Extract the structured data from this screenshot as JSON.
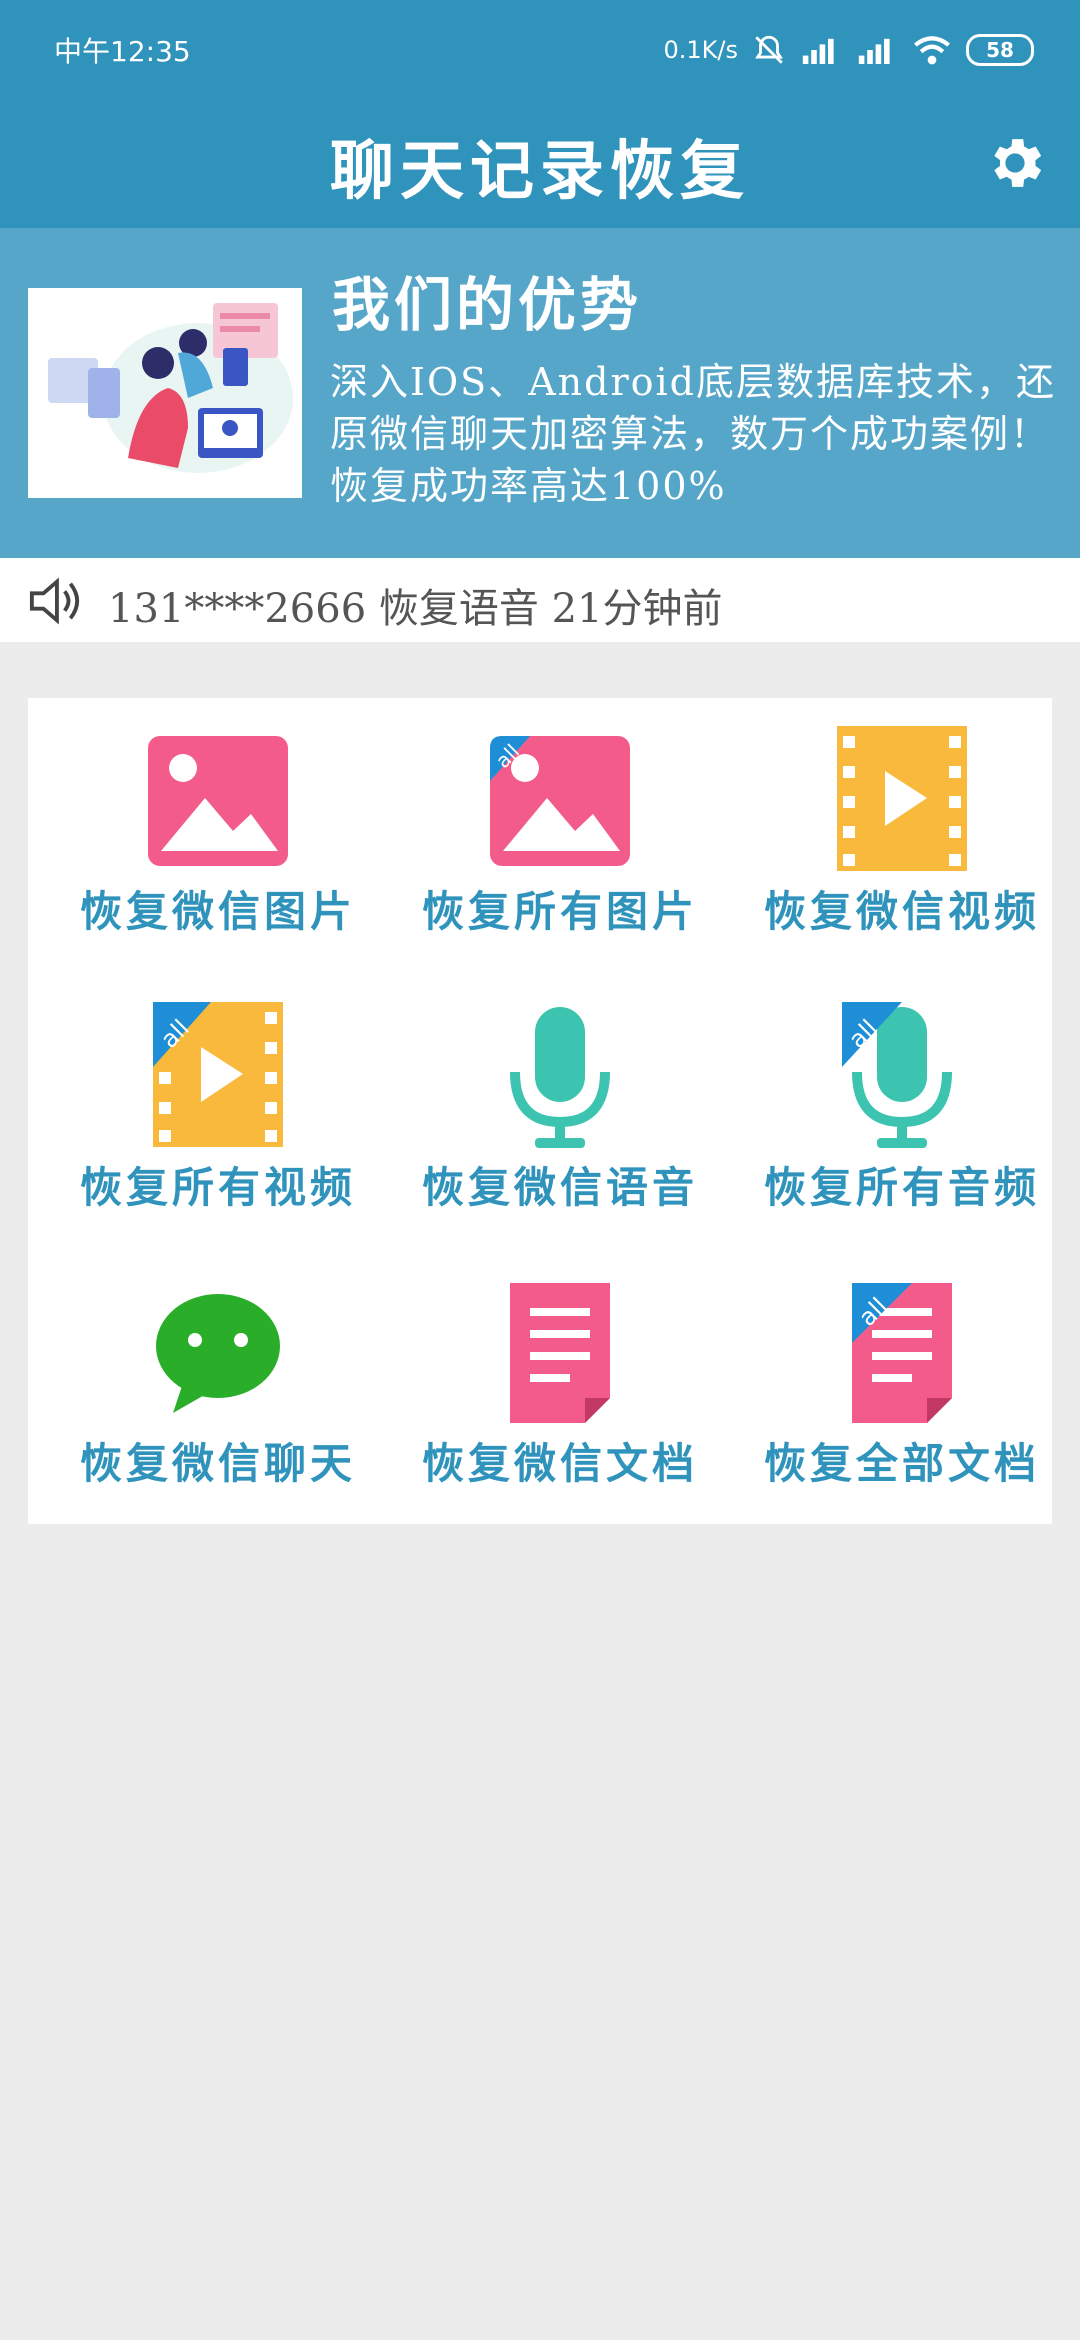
{
  "status_bar": {
    "time": "中午12:35",
    "speed": "0.1K/s",
    "battery": "58",
    "icons": [
      "bell-off-icon",
      "signal-hd-icon",
      "signal-icon",
      "wifi-icon",
      "battery-icon"
    ]
  },
  "app_bar": {
    "title": "聊天记录恢复",
    "settings_icon": "gear-icon"
  },
  "banner": {
    "title": "我们的优势",
    "description": "深入IOS、Android底层数据库技术，还原微信聊天加密算法，数万个成功案例！恢复成功率高达100%"
  },
  "notice": {
    "icon": "speaker-icon",
    "text": "131****2666 恢复语音 21分钟前"
  },
  "grid": {
    "items": [
      {
        "label": "恢复微信图片",
        "icon": "image-icon"
      },
      {
        "label": "恢复所有图片",
        "icon": "image-all-icon"
      },
      {
        "label": "恢复微信视频",
        "icon": "video-icon"
      },
      {
        "label": "恢复所有视频",
        "icon": "video-all-icon"
      },
      {
        "label": "恢复微信语音",
        "icon": "microphone-icon"
      },
      {
        "label": "恢复所有音频",
        "icon": "microphone-all-icon"
      },
      {
        "label": "恢复微信聊天",
        "icon": "chat-bubble-icon"
      },
      {
        "label": "恢复微信文档",
        "icon": "document-icon"
      },
      {
        "label": "恢复全部文档",
        "icon": "document-all-icon"
      }
    ]
  },
  "colors": {
    "primary": "#2f93bc",
    "banner": "#55a6c8",
    "pink": "#f35b8a",
    "yellow": "#f9b93c",
    "teal": "#3cc4b0",
    "green": "#2aae2a",
    "background": "#ececec"
  }
}
